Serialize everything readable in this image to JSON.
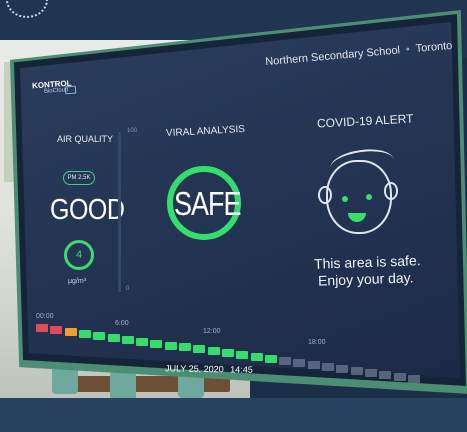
{
  "header": {
    "school": "Northern Secondary School",
    "separator": "•",
    "city": "Toronto"
  },
  "brand": {
    "name": "KONTROL",
    "sub": "BioCloud"
  },
  "air_quality": {
    "heading": "AIR QUALITY",
    "pollutant_label": "PM 2.5K",
    "status": "GOOD",
    "value": "4",
    "unit": "μg/m³",
    "scale_max_label": "100",
    "scale_min_label": "0"
  },
  "viral_analysis": {
    "heading": "VIRAL ANALYSIS",
    "status": "SAFE"
  },
  "covid_alert": {
    "heading": "COVID-19 ALERT",
    "message_line1": "This area is safe.",
    "message_line2": "Enjoy your day."
  },
  "timeline": {
    "ticks": [
      "00:00",
      "6:00",
      "12:00",
      "18:00"
    ],
    "date": "JULY 25, 2020",
    "time": "14:45",
    "segments": [
      "red",
      "red",
      "orange",
      "green",
      "green",
      "green",
      "green",
      "green",
      "green",
      "green",
      "green",
      "green",
      "green",
      "green",
      "green",
      "green",
      "green",
      "gray",
      "gray",
      "gray",
      "gray",
      "gray",
      "gray",
      "gray",
      "gray",
      "gray",
      "gray"
    ]
  },
  "colors": {
    "safe_green": "#34dd6c",
    "red": "#e04a5a",
    "orange": "#f0a030",
    "gray": "#6b7892",
    "screen_bg": "#233352"
  }
}
